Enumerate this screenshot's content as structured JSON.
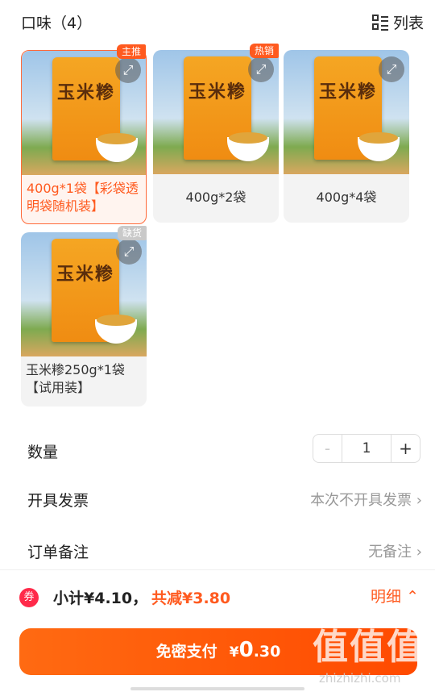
{
  "flavor_section": {
    "title": "口味（4）",
    "list_toggle_label": "列表"
  },
  "skus": [
    {
      "label": "400g*1袋【彩袋透明袋随机装】",
      "tag": "主推",
      "selected": true
    },
    {
      "label": "400g*2袋",
      "tag": "热销",
      "selected": false
    },
    {
      "label": "400g*4袋",
      "tag": "",
      "selected": false
    },
    {
      "label": "玉米糁250g*1袋【试用装】",
      "tag": "缺货",
      "selected": false
    }
  ],
  "product_art": {
    "title": "玉米糁"
  },
  "quantity": {
    "label": "数量",
    "value": "1",
    "minus": "-",
    "plus": "+"
  },
  "invoice": {
    "label": "开具发票",
    "value": "本次不开具发票"
  },
  "order_note": {
    "label": "订单备注",
    "value": "无备注"
  },
  "summary": {
    "subtotal": "小计¥4.10，",
    "discount": "共减¥3.80",
    "detail_label": "明细"
  },
  "pay": {
    "label": "免密支付",
    "currency": "¥",
    "amount_int": "0",
    "amount_dec": ".30"
  },
  "watermark": {
    "text": "值值值",
    "url": "zhizhizhi.com"
  },
  "colors": {
    "accent": "#ff5a1f",
    "tag_gray": "#c9c9c9"
  }
}
